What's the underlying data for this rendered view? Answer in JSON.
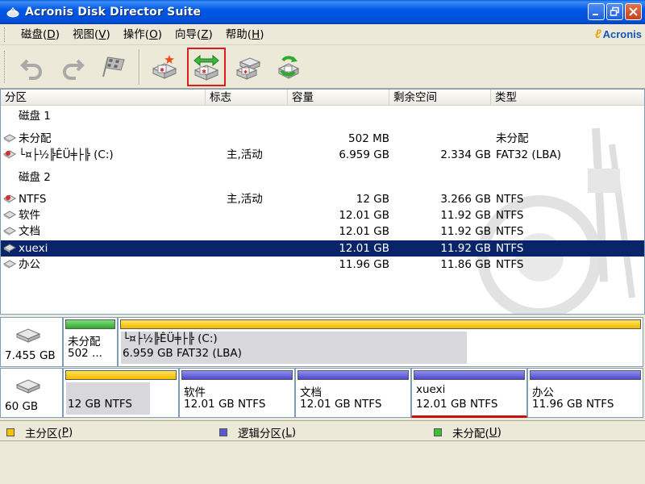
{
  "window": {
    "title": "Acronis Disk Director Suite"
  },
  "menu": [
    {
      "label": "磁盘(",
      "accel": "D",
      "end": ")"
    },
    {
      "label": "视图(",
      "accel": "V",
      "end": ")"
    },
    {
      "label": "操作(",
      "accel": "O",
      "end": ")"
    },
    {
      "label": "向导(",
      "accel": "Z",
      "end": ")"
    },
    {
      "label": "帮助(",
      "accel": "H",
      "end": ")"
    }
  ],
  "brand": "Acronis",
  "toolbar": {
    "buttons": [
      {
        "name": "undo-icon"
      },
      {
        "name": "redo-icon"
      },
      {
        "name": "commit-flag-icon"
      },
      {
        "name": "create-partition-icon"
      },
      {
        "name": "resize-partition-icon",
        "selected": true
      },
      {
        "name": "copy-partition-icon"
      },
      {
        "name": "recovery-icon"
      }
    ]
  },
  "columns": {
    "partition": "分区",
    "flags": "标志",
    "capacity": "容量",
    "free": "剩余空间",
    "type": "类型"
  },
  "disks": [
    {
      "header": "磁盘 1",
      "rows": [
        {
          "name": "未分配",
          "flags": "",
          "capacity": "502 MB",
          "free": "",
          "type": "未分配"
        },
        {
          "name": "└¤├½╠ÊÜ╪├╠ (C:)",
          "flags": "主,活动",
          "capacity": "6.959 GB",
          "free": "2.334 GB",
          "type": "FAT32 (LBA)"
        }
      ]
    },
    {
      "header": "磁盘 2",
      "rows": [
        {
          "name": "NTFS",
          "flags": "主,活动",
          "capacity": "12 GB",
          "free": "3.266 GB",
          "type": "NTFS"
        },
        {
          "name": "软件",
          "flags": "",
          "capacity": "12.01 GB",
          "free": "11.92 GB",
          "type": "NTFS"
        },
        {
          "name": "文档",
          "flags": "",
          "capacity": "12.01 GB",
          "free": "11.92 GB",
          "type": "NTFS"
        },
        {
          "name": "xuexi",
          "flags": "",
          "capacity": "12.01 GB",
          "free": "11.92 GB",
          "type": "NTFS",
          "selected": true
        },
        {
          "name": "办公",
          "flags": "",
          "capacity": "11.96 GB",
          "free": "11.86 GB",
          "type": "NTFS"
        }
      ]
    }
  ],
  "map": {
    "disk1": {
      "size": "7.455 GB",
      "parts": [
        {
          "kind": "unalloc",
          "line1": "未分配",
          "line2": "502 ...",
          "used": 0
        },
        {
          "kind": "primary",
          "line1": "└¤├½╠ÊÜ╪├╠ (C:)",
          "line2": "6.959 GB  FAT32 (LBA)",
          "used": 0.66
        }
      ]
    },
    "disk2": {
      "size": "60 GB",
      "parts": [
        {
          "kind": "primary",
          "line1": "",
          "line2": "12 GB  NTFS",
          "used": 0.73
        },
        {
          "kind": "logical",
          "line1": "软件",
          "line2": "12.01 GB  NTFS",
          "used": 0.01
        },
        {
          "kind": "logical",
          "line1": "文档",
          "line2": "12.01 GB  NTFS",
          "used": 0.01
        },
        {
          "kind": "logical",
          "line1": "xuexi",
          "line2": "12.01 GB  NTFS",
          "used": 0.01,
          "selected": true
        },
        {
          "kind": "logical",
          "line1": "办公",
          "line2": "11.96 GB  NTFS",
          "used": 0.01
        }
      ]
    }
  },
  "legend": [
    {
      "label": "主分区(",
      "accel": "P",
      "end": ")",
      "color": "#f4c400"
    },
    {
      "label": "逻辑分区(",
      "accel": "L",
      "end": ")",
      "color": "#5a5ad0"
    },
    {
      "label": "未分配(",
      "accel": "U",
      "end": ")",
      "color": "#3cc03c"
    }
  ]
}
